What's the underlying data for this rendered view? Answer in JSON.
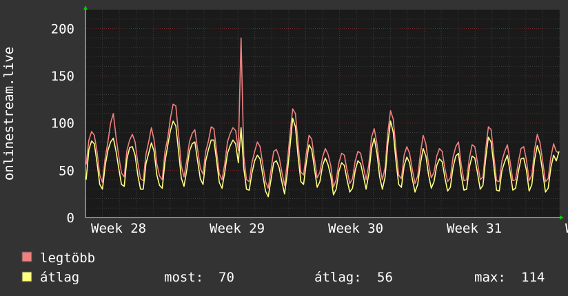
{
  "chart_data": {
    "type": "line",
    "title": "",
    "ylabel": "onlinestream.live",
    "xlabel": "",
    "ylim": [
      0,
      220
    ],
    "y_ticks": [
      0,
      50,
      100,
      150,
      200
    ],
    "x_ticks": [
      "Week 28",
      "Week 29",
      "Week 30",
      "Week 31",
      "Week"
    ],
    "x_tick_positions_weeks": [
      27.5,
      28.5,
      29.5,
      30.5,
      31.5
    ],
    "xlim_weeks": [
      27.5,
      31.5
    ],
    "grid": true,
    "legend_position": "bottom",
    "series": [
      {
        "name": "legtöbb",
        "color": "#f08080",
        "values": [
          56,
          82,
          91,
          87,
          70,
          45,
          37,
          63,
          80,
          100,
          110,
          85,
          65,
          47,
          43,
          71,
          82,
          88,
          80,
          58,
          41,
          39,
          67,
          80,
          95,
          82,
          57,
          44,
          40,
          70,
          84,
          105,
          120,
          118,
          88,
          55,
          43,
          60,
          80,
          89,
          93,
          72,
          52,
          46,
          70,
          81,
          96,
          94,
          70,
          46,
          40,
          57,
          80,
          89,
          95,
          92,
          71,
          190,
          65,
          40,
          38,
          58,
          70,
          80,
          75,
          56,
          38,
          31,
          50,
          70,
          72,
          64,
          48,
          34,
          58,
          88,
          115,
          110,
          78,
          48,
          45,
          68,
          87,
          83,
          62,
          42,
          48,
          64,
          73,
          67,
          55,
          32,
          40,
          58,
          68,
          66,
          50,
          36,
          41,
          60,
          70,
          68,
          54,
          40,
          56,
          85,
          94,
          78,
          55,
          40,
          53,
          90,
          113,
          104,
          72,
          45,
          41,
          66,
          75,
          68,
          51,
          36,
          44,
          68,
          87,
          78,
          56,
          42,
          48,
          65,
          73,
          70,
          52,
          38,
          42,
          64,
          75,
          80,
          56,
          39,
          40,
          63,
          77,
          75,
          58,
          40,
          43,
          72,
          96,
          93,
          66,
          39,
          38,
          60,
          70,
          77,
          59,
          39,
          40,
          58,
          73,
          75,
          61,
          39,
          45,
          72,
          88,
          79,
          59,
          38,
          41,
          64,
          78,
          70,
          68
        ]
      },
      {
        "name": "átlag",
        "color": "#ffff80",
        "values": [
          40,
          72,
          81,
          78,
          58,
          35,
          30,
          55,
          71,
          80,
          84,
          70,
          52,
          35,
          33,
          62,
          74,
          75,
          66,
          45,
          30,
          30,
          57,
          68,
          79,
          70,
          45,
          34,
          31,
          59,
          76,
          92,
          102,
          97,
          70,
          42,
          33,
          50,
          70,
          78,
          80,
          60,
          41,
          35,
          60,
          72,
          82,
          82,
          60,
          37,
          31,
          48,
          68,
          76,
          82,
          78,
          58,
          95,
          52,
          30,
          29,
          47,
          60,
          66,
          62,
          45,
          28,
          22,
          40,
          58,
          60,
          53,
          38,
          25,
          47,
          75,
          105,
          96,
          64,
          38,
          35,
          58,
          77,
          72,
          52,
          32,
          38,
          55,
          63,
          56,
          44,
          24,
          30,
          49,
          58,
          55,
          40,
          27,
          31,
          50,
          60,
          57,
          44,
          30,
          46,
          73,
          84,
          68,
          43,
          30,
          43,
          78,
          102,
          90,
          60,
          35,
          32,
          55,
          64,
          58,
          41,
          27,
          35,
          57,
          73,
          65,
          45,
          31,
          38,
          55,
          62,
          59,
          42,
          28,
          32,
          53,
          65,
          68,
          45,
          29,
          30,
          53,
          65,
          63,
          47,
          30,
          34,
          62,
          85,
          80,
          55,
          29,
          28,
          50,
          59,
          66,
          48,
          29,
          31,
          48,
          62,
          63,
          50,
          28,
          35,
          61,
          76,
          67,
          48,
          27,
          31,
          53,
          66,
          60,
          70
        ]
      }
    ]
  },
  "legend": {
    "items": [
      {
        "label": "legtöbb",
        "color": "#f08080"
      },
      {
        "label": "átlag",
        "color": "#ffff80"
      }
    ],
    "stats": {
      "now_label": "most:",
      "now_value": "70",
      "avg_label": "átlag:",
      "avg_value": "56",
      "max_label": "max:",
      "max_value": "114"
    }
  },
  "colors": {
    "background": "#333333",
    "plot_background": "#1a1a1a",
    "grid_minor": "#3a3a3a",
    "grid_major": "#6b2b2b",
    "axis_arrow": "#00cc00"
  }
}
